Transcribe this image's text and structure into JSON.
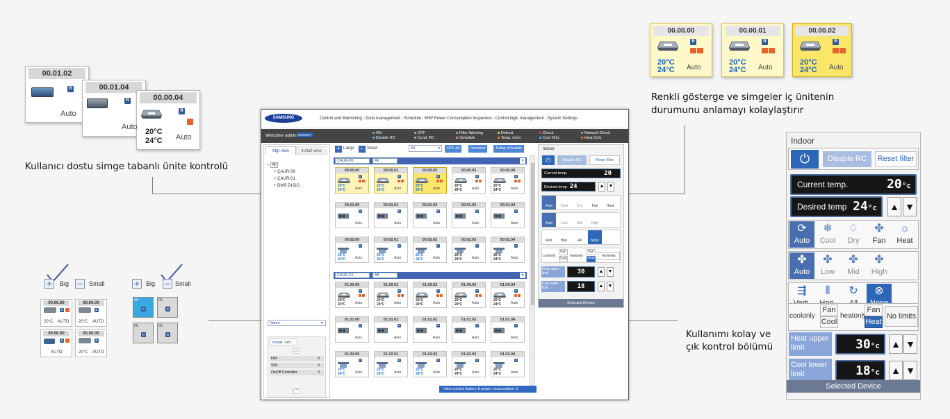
{
  "captions": {
    "icon_control": "Kullanıcı dostu simge tabanlı ünite kontrolü",
    "color_indicator_line1": "Renkli gösterge ve simgeler iç ünitenin",
    "color_indicator_line2": "durumunu anlamayı kolaylaştırır",
    "easy_control_line1": "Kullanımı kolay ve",
    "easy_control_line2": "çık kontrol bölümü"
  },
  "stacked_cards": [
    {
      "id": "00.01.02",
      "mode": "Auto"
    },
    {
      "id": "00.01.04",
      "mode": "Auto"
    },
    {
      "id": "00.00.04",
      "mode": "Auto",
      "temp1": "20°C",
      "temp2": "24°C"
    }
  ],
  "top_cards": [
    {
      "id": "00.00.00",
      "temp1": "20°C",
      "temp2": "24°C",
      "mode": "Auto",
      "style": "pale"
    },
    {
      "id": "00.00.01",
      "temp1": "20°C",
      "temp2": "24°C",
      "mode": "Auto",
      "style": "pale"
    },
    {
      "id": "00.00.02",
      "temp1": "20°C",
      "temp2": "24°C",
      "mode": "Auto",
      "style": "yellow"
    }
  ],
  "size_demo": {
    "big_label": "Big",
    "small_label": "Small",
    "big_cards": [
      {
        "id": "00.00.00",
        "left": "20°C",
        "right": "AUTO"
      },
      {
        "id": "00.00.00",
        "left": "20°C",
        "right": "AUTO"
      },
      {
        "id": "00.00.00",
        "left": "",
        "right": "AUTO"
      },
      {
        "id": "00.00.00",
        "left": "20°C",
        "right": "AUTO"
      }
    ],
    "small_cards": [
      "00.",
      "00.",
      "00.",
      "00."
    ]
  },
  "app": {
    "logo": "SAMSUNG",
    "nav": [
      "Control and Monitoring",
      "Zone management",
      "Schedule",
      "EHP Power Consumption Inspection",
      "Control logic management",
      "System Settings"
    ],
    "welcome": "Welcome! admin",
    "logout": "LOGOUT",
    "legend": [
      [
        "ON",
        "Disable RC"
      ],
      [
        "OFF",
        "Cond. RC"
      ],
      [
        "Filter Warning",
        "Schedule"
      ],
      [
        "Defrost",
        "Temp. Limit"
      ],
      [
        "Check",
        "Cool Only"
      ],
      [
        "Network Check",
        "Heat Only"
      ]
    ],
    "tabs": [
      "Mgt view",
      "Install view"
    ],
    "tree": [
      "All",
      "CAUR-00",
      "CAUR-01",
      "DMS DI-DO"
    ],
    "filter_select": "Name",
    "install_info_title": "Install. Info.",
    "install_info": [
      [
        "FIM",
        "0"
      ],
      [
        "SIM",
        "0"
      ],
      [
        "On/Off Controller",
        "2"
      ]
    ],
    "toolbar": {
      "large": "Large",
      "small": "Small",
      "select": "All",
      "off_all": "OFF All",
      "deselect": "Deselect",
      "today": "Today schedule"
    },
    "groups": [
      {
        "name": "CAUR-00",
        "filter": "All",
        "rows": [
          [
            "00.00.00",
            "00.00.01",
            "00.00.02",
            "00.00.03",
            "00.00.04"
          ],
          [
            "00.01.00",
            "00.01.01",
            "00.01.02",
            "00.01.03",
            "00.01.04"
          ],
          [
            "00.02.00",
            "00.02.01",
            "00.02.02",
            "00.02.03",
            "00.02.04"
          ]
        ]
      },
      {
        "name": "CAUR-01",
        "filter": "All",
        "rows": [
          [
            "01.00.00",
            "01.00.01",
            "01.00.02",
            "01.00.03",
            "01.00.04"
          ],
          [
            "01.01.00",
            "01.01.01",
            "01.01.02",
            "01.01.03",
            "01.01.04"
          ],
          [
            "01.02.00",
            "01.02.01",
            "01.02.02",
            "01.02.03",
            "01.02.04"
          ]
        ]
      }
    ],
    "card_temp1": "20°C",
    "card_temp2": "24°C",
    "card_mode": "Auto",
    "history_link": "View control history & power consumption"
  },
  "indoor": {
    "title": "Indoor",
    "disable_rc": "Disable RC",
    "reset_filter": "Reset filter",
    "current_label": "Current temp.",
    "current_value": "20",
    "desired_label": "Desired temp",
    "desired_value": "24",
    "unit": "°c",
    "modes": [
      "Auto",
      "Cool",
      "Dry",
      "Fan",
      "Heat"
    ],
    "fan_speeds": [
      "Auto",
      "Low",
      "Mid",
      "High"
    ],
    "swing": [
      "Verti.",
      "Hori.",
      "All",
      "None"
    ],
    "coolonly": "coolonly",
    "fan_label": "Fan",
    "cool_label": "Cool",
    "heatonly": "heatonly",
    "heat_label": "Heat",
    "no_limits": "No limits",
    "heat_upper": "Heat upper limit",
    "heat_upper_value": "30",
    "cool_lower": "Cool lower limit",
    "cool_lower_value": "18",
    "selected_device": "Selected Device"
  }
}
